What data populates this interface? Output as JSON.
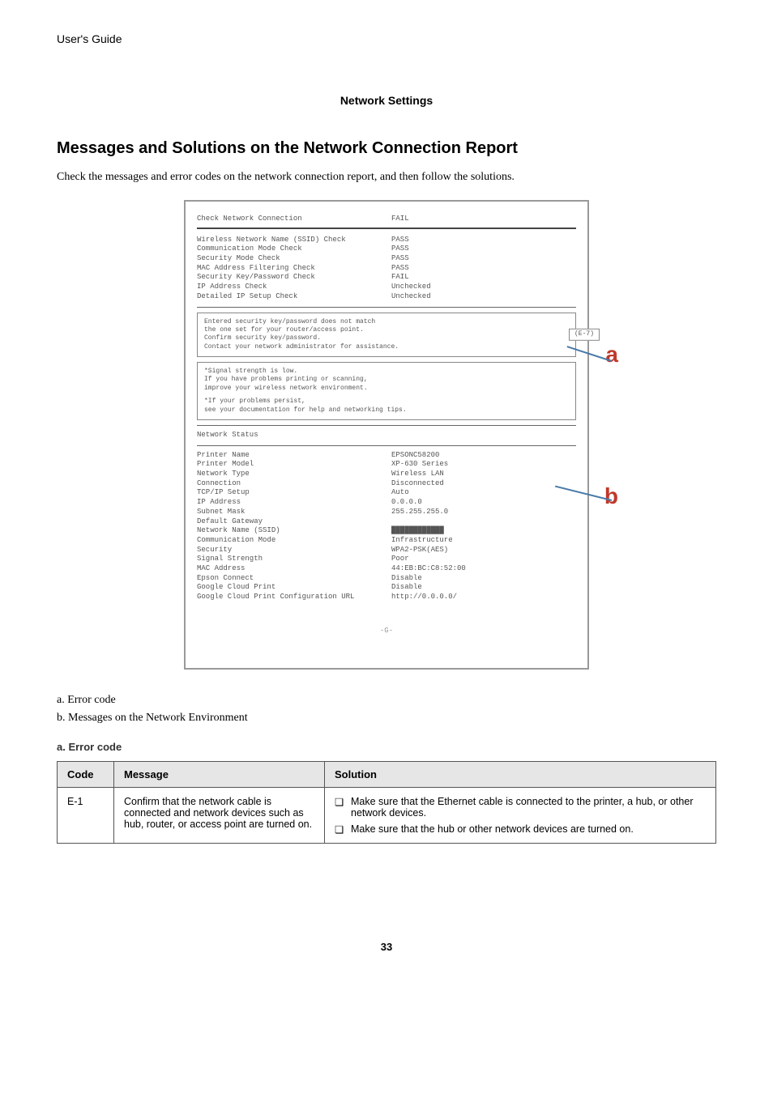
{
  "header": "User's Guide",
  "section_center": "Network Settings",
  "main_heading": "Messages and Solutions on the Network Connection Report",
  "intro": "Check the messages and error codes on the network connection report, and then follow the solutions.",
  "report": {
    "title": "Check Network Connection",
    "title_val": "FAIL",
    "checks": [
      {
        "label": "Wireless Network Name (SSID) Check",
        "value": "PASS"
      },
      {
        "label": "Communication Mode Check",
        "value": "PASS"
      },
      {
        "label": "Security Mode Check",
        "value": "PASS"
      },
      {
        "label": "MAC Address Filtering Check",
        "value": "PASS"
      },
      {
        "label": "Security Key/Password Check",
        "value": "FAIL"
      },
      {
        "label": "IP Address Check",
        "value": "Unchecked"
      },
      {
        "label": "Detailed IP Setup Check",
        "value": "Unchecked"
      }
    ],
    "msg1_line1": "Entered security key/password does not match",
    "msg1_line2": "the one set for your router/access point.",
    "msg1_line3": "Confirm security key/password.",
    "msg1_line4": "Contact your network administrator for assistance.",
    "err_code": "(E-7)",
    "msg2_line1": "*Signal strength is low.",
    "msg2_line2": " If you have problems printing or scanning,",
    "msg2_line3": " improve your wireless network environment.",
    "msg2_line4": "*If your problems persist,",
    "msg2_line5": " see your documentation for help and networking tips.",
    "status_title": "Network Status",
    "status": [
      {
        "label": "Printer Name",
        "value": "EPSONC58200"
      },
      {
        "label": "Printer Model",
        "value": "XP-630 Series"
      },
      {
        "label": "Network Type",
        "value": "Wireless LAN"
      },
      {
        "label": "Connection",
        "value": "Disconnected"
      },
      {
        "label": "TCP/IP Setup",
        "value": "Auto"
      },
      {
        "label": "IP Address",
        "value": "0.0.0.0"
      },
      {
        "label": "Subnet Mask",
        "value": "255.255.255.0"
      },
      {
        "label": "Default Gateway",
        "value": ""
      },
      {
        "label": "Network Name (SSID)",
        "value": "████████████"
      },
      {
        "label": "Communication Mode",
        "value": "Infrastructure"
      },
      {
        "label": "Security",
        "value": "WPA2-PSK(AES)"
      },
      {
        "label": "Signal Strength",
        "value": "Poor"
      },
      {
        "label": "MAC Address",
        "value": "44:EB:BC:C8:52:00"
      },
      {
        "label": "Epson Connect",
        "value": "Disable"
      },
      {
        "label": "Google Cloud Print",
        "value": "Disable"
      },
      {
        "label": "Google Cloud Print Configuration URL",
        "value": "http://0.0.0.0/"
      }
    ],
    "g_marker": "-G-"
  },
  "callout_a": "a",
  "callout_b": "b",
  "legend_a": "a. Error code",
  "legend_b": "b. Messages on the Network Environment",
  "sub_heading": "a. Error code",
  "table": {
    "headers": {
      "code": "Code",
      "message": "Message",
      "solution": "Solution"
    },
    "rows": [
      {
        "code": "E-1",
        "message": "Confirm that the network cable is connected and network devices such as hub, router, or access point are turned on.",
        "solutions": [
          "Make sure that the Ethernet cable is connected to the printer, a hub, or other network devices.",
          "Make sure that the hub or other network devices are turned on."
        ]
      }
    ]
  },
  "page_number": "33"
}
